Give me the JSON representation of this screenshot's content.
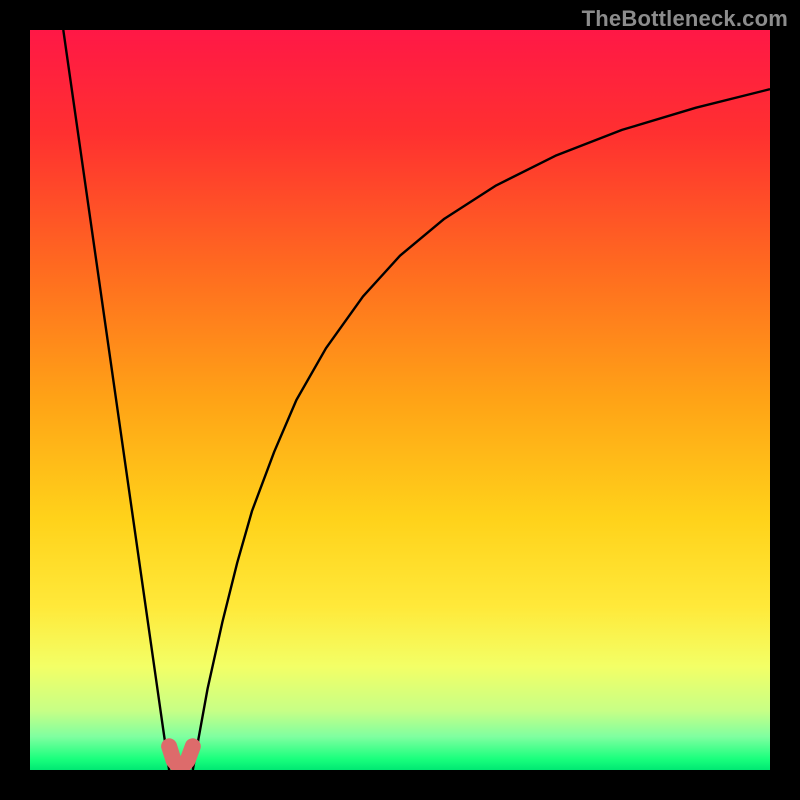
{
  "watermark": "TheBottleneck.com",
  "chart_data": {
    "type": "line",
    "title": "",
    "xlabel": "",
    "ylabel": "",
    "xlim": [
      0,
      100
    ],
    "ylim": [
      0,
      100
    ],
    "grid": false,
    "legend": false,
    "background_gradient_stops": [
      {
        "offset": 0,
        "color": "#ff1846"
      },
      {
        "offset": 0.14,
        "color": "#ff3030"
      },
      {
        "offset": 0.32,
        "color": "#ff6a20"
      },
      {
        "offset": 0.5,
        "color": "#ffa316"
      },
      {
        "offset": 0.66,
        "color": "#ffd21a"
      },
      {
        "offset": 0.78,
        "color": "#ffe93a"
      },
      {
        "offset": 0.86,
        "color": "#f3ff66"
      },
      {
        "offset": 0.92,
        "color": "#c7ff86"
      },
      {
        "offset": 0.955,
        "color": "#7fffa0"
      },
      {
        "offset": 0.985,
        "color": "#1aff7d"
      },
      {
        "offset": 1.0,
        "color": "#00e873"
      }
    ],
    "series": [
      {
        "name": "curve-left",
        "color": "#000000",
        "width": 2.4,
        "x": [
          4.5,
          5.0,
          6.0,
          7.0,
          8.0,
          9.0,
          10.0,
          11.0,
          12.0,
          13.0,
          14.0,
          15.0,
          16.0,
          17.0,
          18.0,
          18.8
        ],
        "y": [
          100,
          96.5,
          89.5,
          82.5,
          75.5,
          68.5,
          61.5,
          54.5,
          47.5,
          40.5,
          33.5,
          26.5,
          19.5,
          12.5,
          5.5,
          0.0
        ]
      },
      {
        "name": "curve-right",
        "color": "#000000",
        "width": 2.4,
        "x": [
          22.0,
          23.0,
          24.0,
          26.0,
          28.0,
          30.0,
          33.0,
          36.0,
          40.0,
          45.0,
          50.0,
          56.0,
          63.0,
          71.0,
          80.0,
          90.0,
          100.0
        ],
        "y": [
          0.0,
          5.5,
          11.0,
          20.0,
          28.0,
          35.0,
          43.0,
          50.0,
          57.0,
          64.0,
          69.5,
          74.5,
          79.0,
          83.0,
          86.5,
          89.5,
          92.0
        ]
      },
      {
        "name": "marker-bottom",
        "color": "#dd6b6b",
        "width": 16,
        "linecap": "round",
        "x": [
          18.8,
          19.4,
          20.0,
          20.7,
          21.3,
          22.0
        ],
        "y": [
          3.2,
          1.3,
          0.6,
          0.6,
          1.3,
          3.2
        ]
      }
    ],
    "optimal_x": 20.4
  }
}
